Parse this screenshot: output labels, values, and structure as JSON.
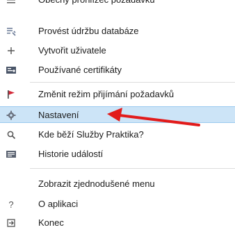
{
  "menu": {
    "items": [
      {
        "label": "Obecný prohlížeč požadavků",
        "icon": "list-icon"
      },
      {
        "label": "Provést údržbu databáze",
        "icon": "database-maintenance-icon"
      },
      {
        "label": "Vytvořit uživatele",
        "icon": "plus-icon"
      },
      {
        "label": "Používané certifikáty",
        "icon": "certificate-icon"
      },
      {
        "label": "Změnit režim přijímání požadavků",
        "icon": "red-flag-icon"
      },
      {
        "label": "Nastavení",
        "icon": "gear-icon"
      },
      {
        "label": "Kde běží Služby Praktika?",
        "icon": "search-icon"
      },
      {
        "label": "Historie událostí",
        "icon": "history-icon"
      },
      {
        "label": "Zobrazit zjednodušené menu",
        "icon": ""
      },
      {
        "label": "O aplikaci",
        "icon": "question-icon"
      },
      {
        "label": "Konec",
        "icon": "exit-icon"
      }
    ],
    "highlighted": "Nastavení",
    "accent_color": "#cce4f7",
    "annotation_color": "#e21b1b"
  }
}
